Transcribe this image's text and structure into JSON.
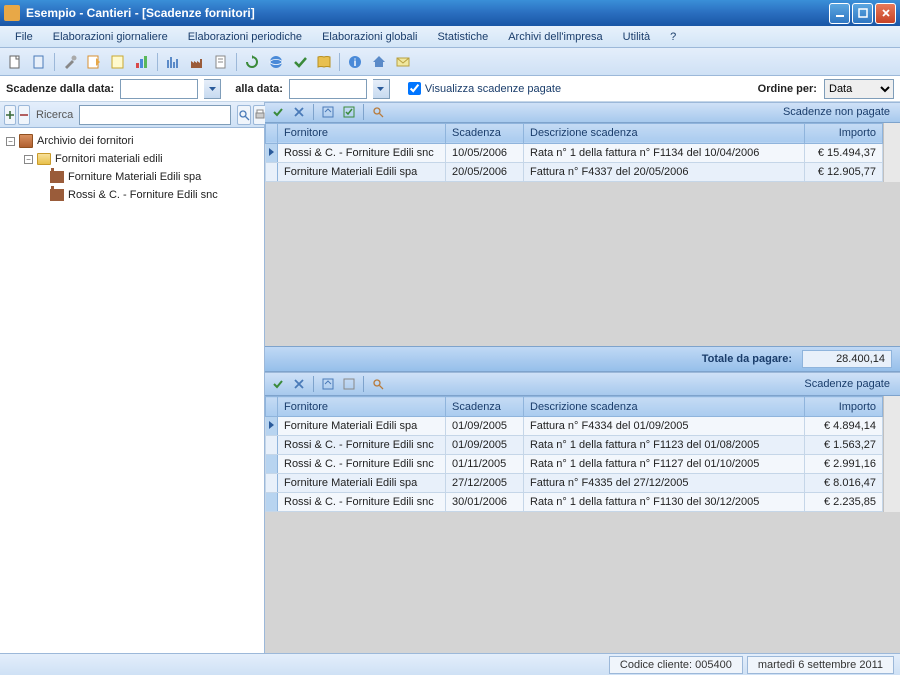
{
  "title": "Esempio - Cantieri - [Scadenze fornitori]",
  "menu": [
    "File",
    "Elaborazioni giornaliere",
    "Elaborazioni periodiche",
    "Elaborazioni globali",
    "Statistiche",
    "Archivi dell'impresa",
    "Utilità",
    "?"
  ],
  "filter": {
    "from_label": "Scadenze dalla data:",
    "to_label": "alla data:",
    "checkbox_label": "Visualizza scadenze pagate",
    "checkbox_checked": true,
    "ordine_label": "Ordine per:",
    "ordine_value": "Data"
  },
  "sidebar": {
    "search_label": "Ricerca",
    "tree": {
      "root": "Archivio dei fornitori",
      "group": "Fornitori materiali edili",
      "items": [
        "Forniture Materiali Edili spa",
        "Rossi & C. - Forniture Edili snc"
      ]
    }
  },
  "grid_top": {
    "caption": "Scadenze non pagate",
    "cols": [
      "Fornitore",
      "Scadenza",
      "Descrizione scadenza",
      "Importo"
    ],
    "rows": [
      {
        "fornitore": "Rossi & C. - Forniture Edili snc",
        "scadenza": "10/05/2006",
        "desc": "Rata n° 1 della fattura n° F1134 del 10/04/2006",
        "importo": "€ 15.494,37"
      },
      {
        "fornitore": "Forniture Materiali Edili spa",
        "scadenza": "20/05/2006",
        "desc": "Fattura n° F4337 del 20/05/2006",
        "importo": "€ 12.905,77"
      }
    ]
  },
  "totale": {
    "label": "Totale da pagare:",
    "value": "28.400,14"
  },
  "grid_bot": {
    "caption": "Scadenze pagate",
    "cols": [
      "Fornitore",
      "Scadenza",
      "Descrizione scadenza",
      "Importo"
    ],
    "rows": [
      {
        "fornitore": "Forniture Materiali Edili spa",
        "scadenza": "01/09/2005",
        "desc": "Fattura n° F4334 del 01/09/2005",
        "importo": "€ 4.894,14"
      },
      {
        "fornitore": "Rossi & C. - Forniture Edili snc",
        "scadenza": "01/09/2005",
        "desc": "Rata n° 1 della fattura n° F1123 del 01/08/2005",
        "importo": "€ 1.563,27"
      },
      {
        "fornitore": "Rossi & C. - Forniture Edili snc",
        "scadenza": "01/11/2005",
        "desc": "Rata n° 1 della fattura n° F1127 del 01/10/2005",
        "importo": "€ 2.991,16"
      },
      {
        "fornitore": "Forniture Materiali Edili spa",
        "scadenza": "27/12/2005",
        "desc": "Fattura n° F4335 del 27/12/2005",
        "importo": "€ 8.016,47"
      },
      {
        "fornitore": "Rossi & C. - Forniture Edili snc",
        "scadenza": "30/01/2006",
        "desc": "Rata n° 1 della fattura n° F1130 del 30/12/2005",
        "importo": "€ 2.235,85"
      }
    ]
  },
  "status": {
    "cliente": "Codice cliente: 005400",
    "data": "martedì 6 settembre 2011"
  }
}
